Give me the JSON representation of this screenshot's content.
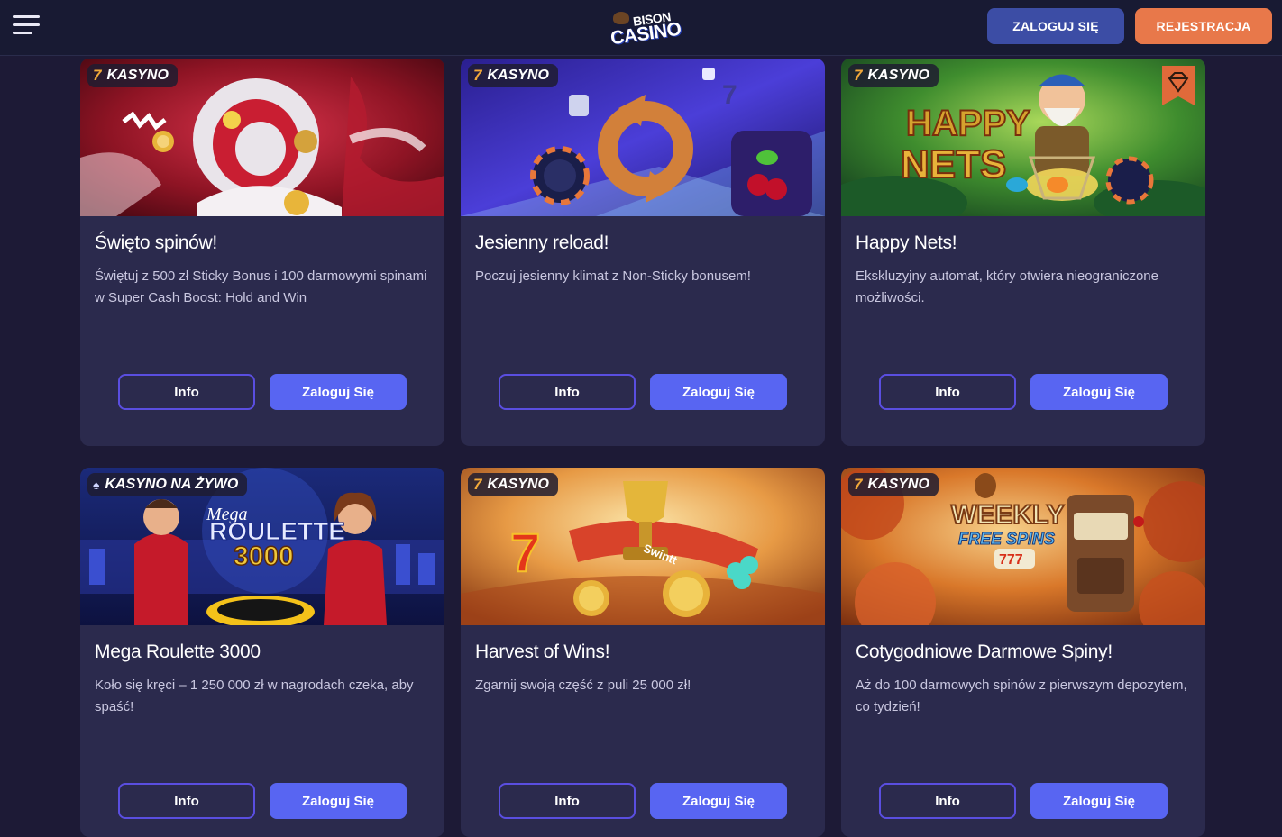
{
  "header": {
    "logo_top": "BISON",
    "logo_bottom": "CASINO",
    "login_label": "ZALOGUJ SIĘ",
    "register_label": "REJESTRACJA"
  },
  "colors": {
    "background": "#1d1a36",
    "card": "#2b2a4d",
    "login_top": "#3c4da5",
    "register": "#e8784a",
    "accent_button": "#5865f2",
    "outline_button": "#5a4ee0"
  },
  "cards": [
    {
      "badge": "KASYNO",
      "badge_icon": "seven-icon",
      "title": "Święto spinów!",
      "description": "Świętuj z 500 zł Sticky Bonus i 100 darmowymi spinami w Super Cash Boost: Hold and Win",
      "info_label": "Info",
      "login_label": "Zaloguj Się"
    },
    {
      "badge": "KASYNO",
      "badge_icon": "seven-icon",
      "title": "Jesienny reload!",
      "description": "Poczuj jesienny klimat z Non-Sticky bonusem!",
      "info_label": "Info",
      "login_label": "Zaloguj Się"
    },
    {
      "badge": "KASYNO",
      "badge_icon": "seven-icon",
      "image_text_1": "HAPPY",
      "image_text_2": "NETS",
      "title": "Happy Nets!",
      "description": "Ekskluzyjny automat, który otwiera nieograniczone możliwości.",
      "info_label": "Info",
      "login_label": "Zaloguj Się"
    },
    {
      "badge": "KASYNO NA ŻYWO",
      "badge_icon": "spade-icon",
      "image_text_1": "Mega",
      "image_text_2": "ROULETTE",
      "image_text_3": "3000",
      "title": "Mega Roulette 3000",
      "description": "Koło się kręci – 1 250 000 zł w nagrodach czeka, aby spaść!",
      "info_label": "Info",
      "login_label": "Zaloguj Się"
    },
    {
      "badge": "KASYNO",
      "badge_icon": "seven-icon",
      "image_text_1": "Swintt",
      "title": "Harvest of Wins!",
      "description": "Zgarnij swoją część z puli 25 000 zł!",
      "info_label": "Info",
      "login_label": "Zaloguj Się"
    },
    {
      "badge": "KASYNO",
      "badge_icon": "seven-icon",
      "image_text_1": "WEEKLY",
      "image_text_2": "FREE SPINS",
      "image_text_3": "777",
      "title": "Cotygodniowe Darmowe Spiny!",
      "description": "Aż do 100 darmowych spinów z pierwszym depozytem, co tydzień!",
      "info_label": "Info",
      "login_label": "Zaloguj Się"
    }
  ]
}
